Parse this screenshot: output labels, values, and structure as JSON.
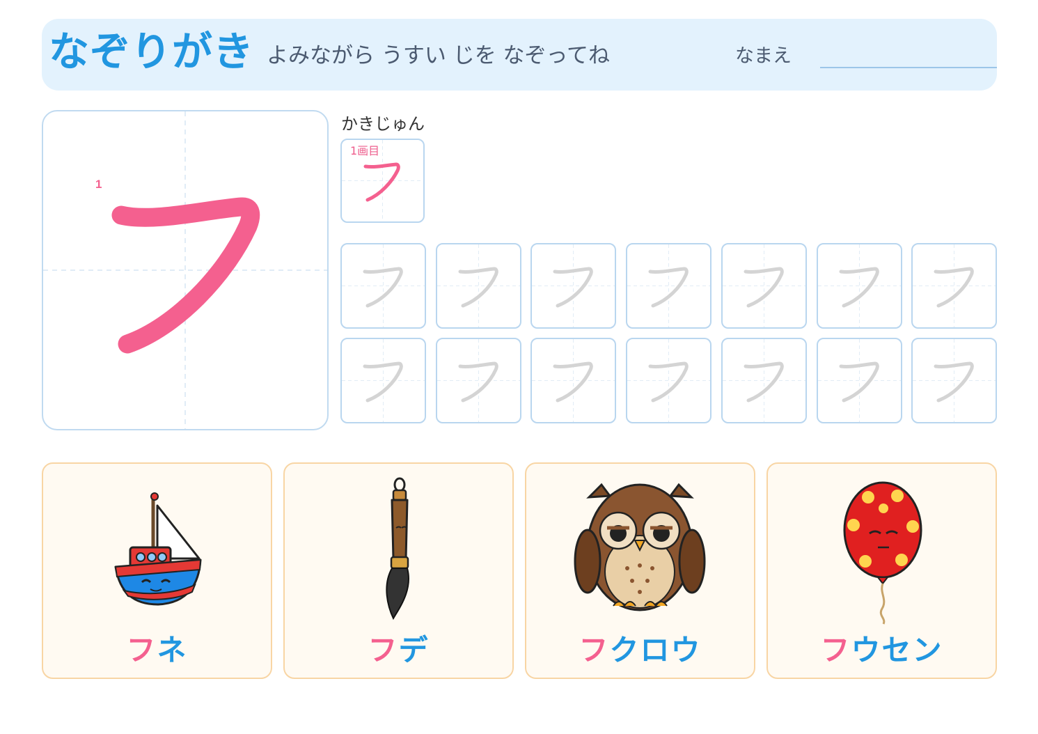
{
  "header": {
    "title": "なぞりがき",
    "subtitle": "よみながら うすい じを なぞってね",
    "name_label": "なまえ"
  },
  "main_char": {
    "glyph": "フ",
    "stroke_number": "1"
  },
  "stroke_order": {
    "label": "かきじゅん",
    "steps": [
      {
        "label": "1画目"
      }
    ]
  },
  "practice": {
    "rows": 2,
    "cols": 7,
    "trace_glyph": "フ"
  },
  "cards": [
    {
      "first": "フ",
      "rest": "ネ",
      "icon": "boat-icon"
    },
    {
      "first": "フ",
      "rest": "デ",
      "icon": "brush-icon"
    },
    {
      "first": "フ",
      "rest": "クロウ",
      "icon": "owl-icon"
    },
    {
      "first": "フ",
      "rest": "ウセン",
      "icon": "balloon-icon"
    }
  ],
  "colors": {
    "accent_pink": "#f4608f",
    "accent_blue": "#2196e0",
    "header_bg": "#e3f2fd",
    "grid_border": "#b9d6ef",
    "card_border": "#f8d5a4",
    "trace_gray": "#d4d4d4"
  }
}
